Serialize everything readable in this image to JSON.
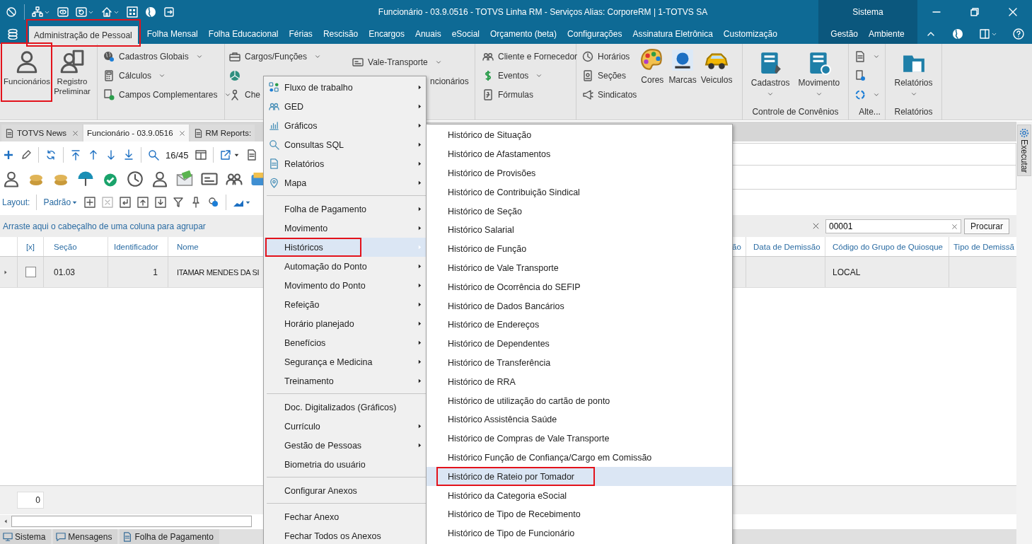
{
  "title_bar": {
    "title": "Funcionário - 03.9.0516 - TOTVS Linha RM - Serviços  Alias: CorporeRM | 1-TOTVS SA",
    "context_label": "Sistema"
  },
  "ribbon_tabs": [
    {
      "label": "Administração de Pessoal",
      "kind": "main",
      "selected": true,
      "annotated": true
    },
    {
      "label": "Folha Mensal",
      "kind": "main",
      "selected": false,
      "annotated": false
    },
    {
      "label": "Folha Educacional",
      "kind": "main",
      "selected": false,
      "annotated": false
    },
    {
      "label": "Férias",
      "kind": "main",
      "selected": false,
      "annotated": false
    },
    {
      "label": "Rescisão",
      "kind": "main",
      "selected": false,
      "annotated": false
    },
    {
      "label": "Encargos",
      "kind": "main",
      "selected": false,
      "annotated": false
    },
    {
      "label": "Anuais",
      "kind": "main",
      "selected": false,
      "annotated": false
    },
    {
      "label": "eSocial",
      "kind": "main",
      "selected": false,
      "annotated": false
    },
    {
      "label": "Orçamento (beta)",
      "kind": "main",
      "selected": false,
      "annotated": false
    },
    {
      "label": "Configurações",
      "kind": "main",
      "selected": false,
      "annotated": false
    },
    {
      "label": "Assinatura Eletrônica",
      "kind": "main",
      "selected": false,
      "annotated": false
    },
    {
      "label": "Customização",
      "kind": "main",
      "selected": false,
      "annotated": false
    },
    {
      "label": "Gestão",
      "kind": "context",
      "selected": false,
      "annotated": false
    },
    {
      "label": "Ambiente",
      "kind": "context",
      "selected": false,
      "annotated": false
    }
  ],
  "ribbon_groups": [
    {
      "items": [
        {
          "kind": "large",
          "label": "Funcionários",
          "dropdown": false,
          "annotated": true
        },
        {
          "kind": "large",
          "label": "Registro Preliminar",
          "dropdown": false,
          "annotated": false
        }
      ]
    },
    {
      "items": [
        {
          "kind": "small",
          "label": "Cadastros Globais",
          "dropdown": true
        },
        {
          "kind": "small",
          "label": "Cálculos",
          "dropdown": true
        },
        {
          "kind": "small",
          "label": "Campos Complementares",
          "dropdown": true
        }
      ]
    },
    {
      "items": [
        {
          "kind": "small",
          "label": "Cargos/Funções",
          "dropdown": true
        },
        {
          "kind": "icon",
          "dropdown": false
        },
        {
          "kind": "small",
          "label": "Che",
          "dropdown": false
        },
        {
          "kind": "small",
          "label": "Vale-Transporte",
          "dropdown": true
        },
        {
          "kind": "text",
          "label": "ncionários"
        }
      ]
    },
    {
      "items": [
        {
          "kind": "small",
          "label": "Cliente e Fornecedor",
          "dropdown": false
        },
        {
          "kind": "small",
          "label": "Eventos",
          "dropdown": true
        },
        {
          "kind": "small",
          "label": "Fórmulas",
          "dropdown": false
        }
      ]
    },
    {
      "items": [
        {
          "kind": "small",
          "label": "Horários",
          "dropdown": false
        },
        {
          "kind": "small",
          "label": "Seções",
          "dropdown": false
        },
        {
          "kind": "small",
          "label": "Sindicatos",
          "dropdown": false
        },
        {
          "kind": "large",
          "label": "Cores",
          "dropdown": false,
          "annotated": false
        },
        {
          "kind": "large",
          "label": "Marcas",
          "dropdown": false,
          "annotated": false
        },
        {
          "kind": "large",
          "label": "Veiculos",
          "dropdown": false,
          "annotated": false
        }
      ]
    },
    {
      "caption": "Controle de Convênios",
      "items": [
        {
          "kind": "large",
          "label": "Cadastros",
          "dropdown": true,
          "annotated": false
        },
        {
          "kind": "large",
          "label": "Movimento",
          "dropdown": true,
          "annotated": false
        }
      ]
    },
    {
      "caption": "Alte...",
      "items": [
        {
          "kind": "icon",
          "dropdown": true
        },
        {
          "kind": "icon",
          "dropdown": false
        },
        {
          "kind": "icon",
          "dropdown": true
        }
      ]
    },
    {
      "caption": "Relatórios",
      "items": [
        {
          "kind": "large",
          "label": "Relatórios",
          "dropdown": true,
          "annotated": false
        }
      ]
    }
  ],
  "document_tabs": [
    {
      "label": "TOTVS News",
      "selected": false,
      "closable": true
    },
    {
      "label": "Funcionário - 03.9.0516",
      "selected": true,
      "closable": true
    },
    {
      "label": "RM Reports:",
      "selected": false,
      "closable": false
    }
  ],
  "toolbar": {
    "counter": "16/45",
    "layout_label": "Layout:",
    "layout_value": "Padrão"
  },
  "group_hint": "Arraste aqui o cabeçalho de uma coluna para agrupar",
  "search": {
    "value": "00001",
    "button": "Procurar"
  },
  "table": {
    "columns": [
      "[x]",
      "Seção",
      "Identificador",
      "Nome",
      "ão",
      "Data de Demissão",
      "Código do Grupo de Quiosque",
      "Tipo de Demissã"
    ],
    "rows": [
      {
        "checked": false,
        "cells": [
          "",
          "01.03",
          "1",
          "ITAMAR MENDES DA SI",
          "",
          "",
          "LOCAL",
          ""
        ]
      }
    ]
  },
  "footer_count": "0",
  "side_tab": "Executar",
  "bottom_tabs": [
    "Sistema",
    "Mensagens",
    "Folha de Pagamento"
  ],
  "menu": [
    {
      "kind": "item",
      "label": "Fluxo de trabalho",
      "has_submenu": true,
      "selected": false,
      "annotated": false
    },
    {
      "kind": "item",
      "label": "GED",
      "has_submenu": true,
      "selected": false,
      "annotated": false
    },
    {
      "kind": "item",
      "label": "Gráficos",
      "has_submenu": true,
      "selected": false,
      "annotated": false
    },
    {
      "kind": "item",
      "label": "Consultas SQL",
      "has_submenu": true,
      "selected": false,
      "annotated": false
    },
    {
      "kind": "item",
      "label": "Relatórios",
      "has_submenu": true,
      "selected": false,
      "annotated": false
    },
    {
      "kind": "item",
      "label": "Mapa",
      "has_submenu": true,
      "selected": false,
      "annotated": false
    },
    {
      "kind": "separator"
    },
    {
      "kind": "item",
      "label": "Folha de Pagamento",
      "has_submenu": true,
      "selected": false,
      "annotated": false
    },
    {
      "kind": "item",
      "label": "Movimento",
      "has_submenu": true,
      "selected": false,
      "annotated": false
    },
    {
      "kind": "item",
      "label": "Históricos",
      "has_submenu": true,
      "selected": true,
      "annotated": true
    },
    {
      "kind": "item",
      "label": "Automação do Ponto",
      "has_submenu": true,
      "selected": false,
      "annotated": false
    },
    {
      "kind": "item",
      "label": "Movimento do Ponto",
      "has_submenu": true,
      "selected": false,
      "annotated": false
    },
    {
      "kind": "item",
      "label": "Refeição",
      "has_submenu": true,
      "selected": false,
      "annotated": false
    },
    {
      "kind": "item",
      "label": "Horário planejado",
      "has_submenu": true,
      "selected": false,
      "annotated": false
    },
    {
      "kind": "item",
      "label": "Benefícios",
      "has_submenu": true,
      "selected": false,
      "annotated": false
    },
    {
      "kind": "item",
      "label": "Segurança e Medicina",
      "has_submenu": true,
      "selected": false,
      "annotated": false
    },
    {
      "kind": "item",
      "label": "Treinamento",
      "has_submenu": true,
      "selected": false,
      "annotated": false
    },
    {
      "kind": "separator"
    },
    {
      "kind": "item",
      "label": "Doc. Digitalizados (Gráficos)",
      "has_submenu": false,
      "selected": false,
      "annotated": false
    },
    {
      "kind": "item",
      "label": "Currículo",
      "has_submenu": true,
      "selected": false,
      "annotated": false
    },
    {
      "kind": "item",
      "label": "Gestão de Pessoas",
      "has_submenu": true,
      "selected": false,
      "annotated": false
    },
    {
      "kind": "item",
      "label": "Biometria do usuário",
      "has_submenu": false,
      "selected": false,
      "annotated": false
    },
    {
      "kind": "separator"
    },
    {
      "kind": "item",
      "label": "Configurar Anexos",
      "has_submenu": false,
      "selected": false,
      "annotated": false
    },
    {
      "kind": "separator"
    },
    {
      "kind": "item",
      "label": "Fechar Anexo",
      "has_submenu": false,
      "selected": false,
      "annotated": false
    },
    {
      "kind": "item",
      "label": "Fechar Todos os Anexos",
      "has_submenu": false,
      "selected": false,
      "annotated": false
    }
  ],
  "submenu": [
    {
      "label": "Histórico de Situação",
      "selected": false,
      "annotated": false
    },
    {
      "label": "Histórico de Afastamentos",
      "selected": false,
      "annotated": false
    },
    {
      "label": "Histórico de Provisões",
      "selected": false,
      "annotated": false
    },
    {
      "label": "Histórico de Contribuição Sindical",
      "selected": false,
      "annotated": false
    },
    {
      "label": "Histórico de Seção",
      "selected": false,
      "annotated": false
    },
    {
      "label": "Histórico Salarial",
      "selected": false,
      "annotated": false
    },
    {
      "label": "Histórico de Função",
      "selected": false,
      "annotated": false
    },
    {
      "label": "Histórico de Vale Transporte",
      "selected": false,
      "annotated": false
    },
    {
      "label": "Histórico de Ocorrência do SEFIP",
      "selected": false,
      "annotated": false
    },
    {
      "label": "Histórico de Dados Bancários",
      "selected": false,
      "annotated": false
    },
    {
      "label": "Histórico de Endereços",
      "selected": false,
      "annotated": false
    },
    {
      "label": "Histórico de Dependentes",
      "selected": false,
      "annotated": false
    },
    {
      "label": "Histórico de Transferência",
      "selected": false,
      "annotated": false
    },
    {
      "label": "Histórico de RRA",
      "selected": false,
      "annotated": false
    },
    {
      "label": "Histórico de utilização do cartão de ponto",
      "selected": false,
      "annotated": false
    },
    {
      "label": "Histórico Assistência Saúde",
      "selected": false,
      "annotated": false
    },
    {
      "label": "Histórico de Compras de Vale Transporte",
      "selected": false,
      "annotated": false
    },
    {
      "label": "Histórico Função de Confiança/Cargo em Comissão",
      "selected": false,
      "annotated": false
    },
    {
      "label": "Histórico de Rateio por Tomador",
      "selected": true,
      "annotated": true
    },
    {
      "label": "Histórico da Categoria eSocial",
      "selected": false,
      "annotated": false
    },
    {
      "label": "Histórico de Tipo de Recebimento",
      "selected": false,
      "annotated": false
    },
    {
      "label": "Histórico de Tipo de Funcionário",
      "selected": false,
      "annotated": false
    }
  ]
}
